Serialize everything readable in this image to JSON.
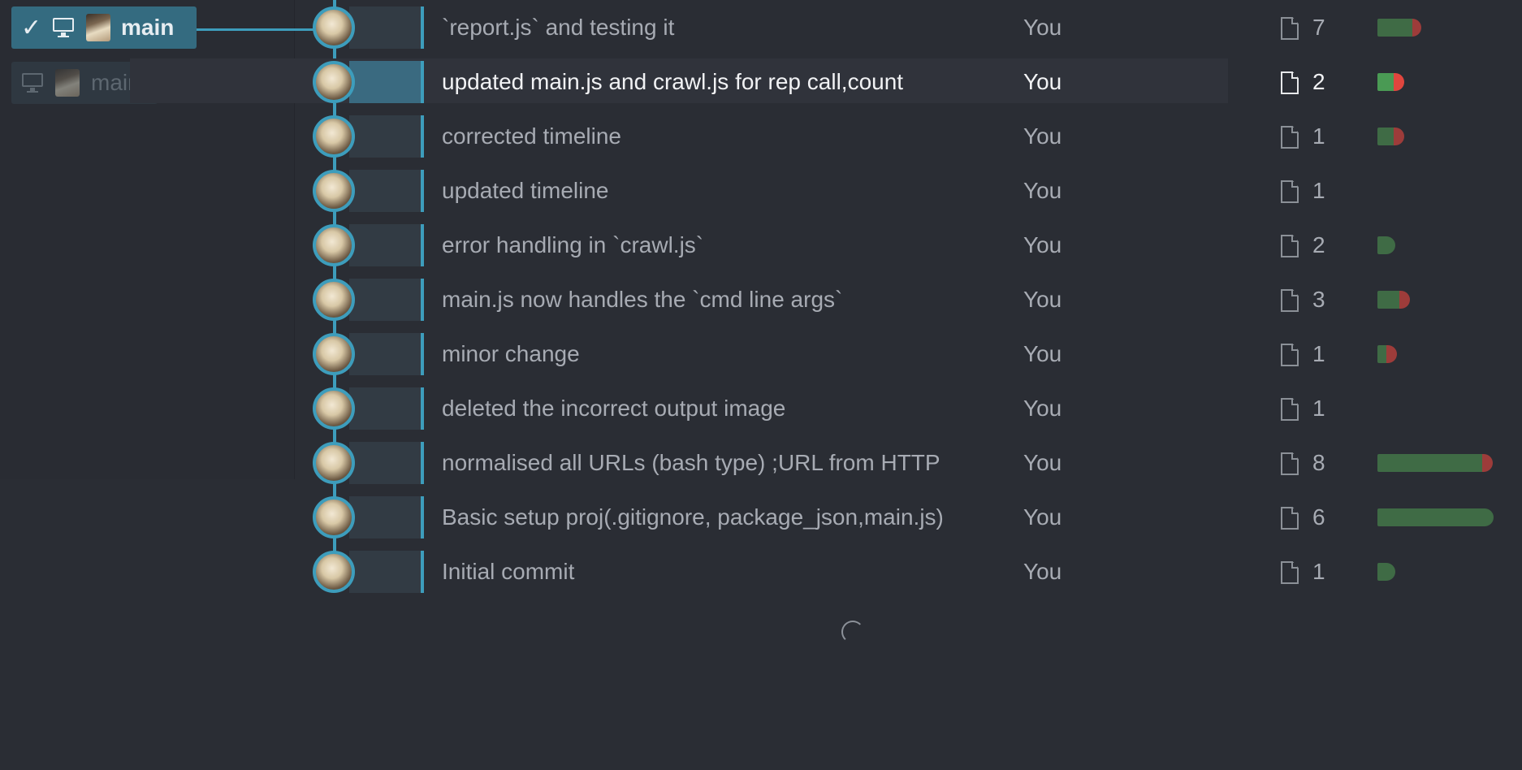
{
  "branches": {
    "local": {
      "name": "main",
      "checked": true
    },
    "remote": {
      "name": "main"
    }
  },
  "commits": [
    {
      "message": "`report.js` and testing it",
      "author": "You",
      "files": "7",
      "diff": {
        "add": 0.38,
        "del": 0.1
      }
    },
    {
      "message": "updated main.js and crawl.js for rep call,count",
      "author": "You",
      "files": "2",
      "selected": true,
      "diff": {
        "add": 0.18,
        "del": 0.12
      }
    },
    {
      "message": "corrected timeline",
      "author": "You",
      "files": "1",
      "diff": {
        "add": 0.18,
        "del": 0.12
      }
    },
    {
      "message": "updated timeline",
      "author": "You",
      "files": "1",
      "diff": null
    },
    {
      "message": "error handling in `crawl.js`",
      "author": "You",
      "files": "2",
      "diff": {
        "add": 0.2,
        "del": 0
      }
    },
    {
      "message": "main.js now handles the `cmd line args`",
      "author": "You",
      "files": "3",
      "diff": {
        "add": 0.24,
        "del": 0.12
      }
    },
    {
      "message": "minor change",
      "author": "You",
      "files": "1",
      "diff": {
        "add": 0.1,
        "del": 0.12
      }
    },
    {
      "message": "deleted the incorrect output image",
      "author": "You",
      "files": "1",
      "diff": null
    },
    {
      "message": "normalised all URLs (bash type) ;URL from HTTP",
      "author": "You",
      "files": "8",
      "diff": {
        "add": 1.15,
        "del": 0.12
      }
    },
    {
      "message": "Basic setup proj(.gitignore, package_json,main.js)",
      "author": "You",
      "files": "6",
      "diff": {
        "add": 1.28,
        "del": 0
      }
    },
    {
      "message": "Initial commit",
      "author": "You",
      "files": "1",
      "diff": {
        "add": 0.2,
        "del": 0
      }
    }
  ],
  "colors": {
    "graph": "#3d9dbc",
    "added": "#3f6b45",
    "deleted": "#9d3c3a",
    "background": "#2a2d34"
  },
  "icons": {
    "check": "check-icon",
    "monitor": "monitor-icon",
    "file": "file-icon",
    "spinner": "loading-spinner-icon"
  }
}
